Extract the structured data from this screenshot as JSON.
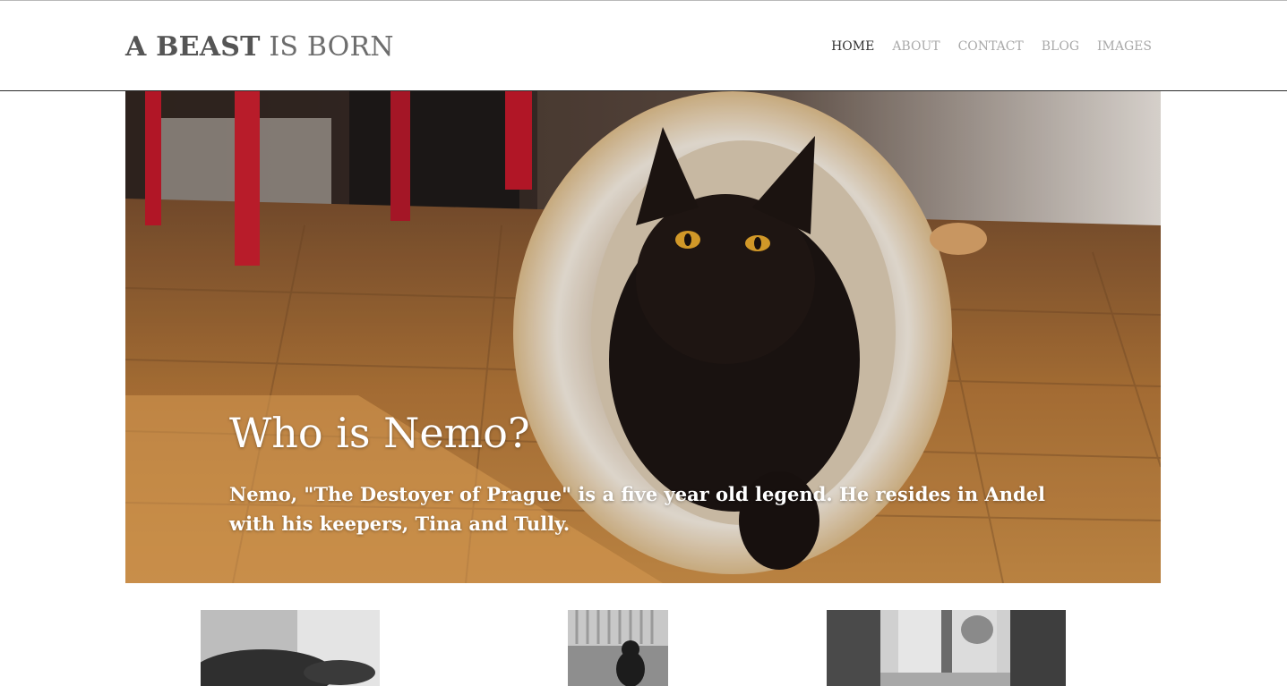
{
  "site": {
    "title_part1": "A BEAST",
    "title_part2": " IS BORN"
  },
  "nav": {
    "items": [
      {
        "label": "HOME",
        "active": true
      },
      {
        "label": "ABOUT",
        "active": false
      },
      {
        "label": "CONTACT",
        "active": false
      },
      {
        "label": "BLOG",
        "active": false
      },
      {
        "label": "IMAGES",
        "active": false
      }
    ]
  },
  "hero": {
    "title": "Who is Nemo?",
    "subtitle": "Nemo, \"The Destoyer of Prague\" is a five year old legend. He resides in Andel with his keepers, Tina and Tully."
  },
  "colors": {
    "nav_active": "#333333",
    "nav_inactive": "#a9a9a9",
    "header_rule": "#2b2b2b"
  }
}
